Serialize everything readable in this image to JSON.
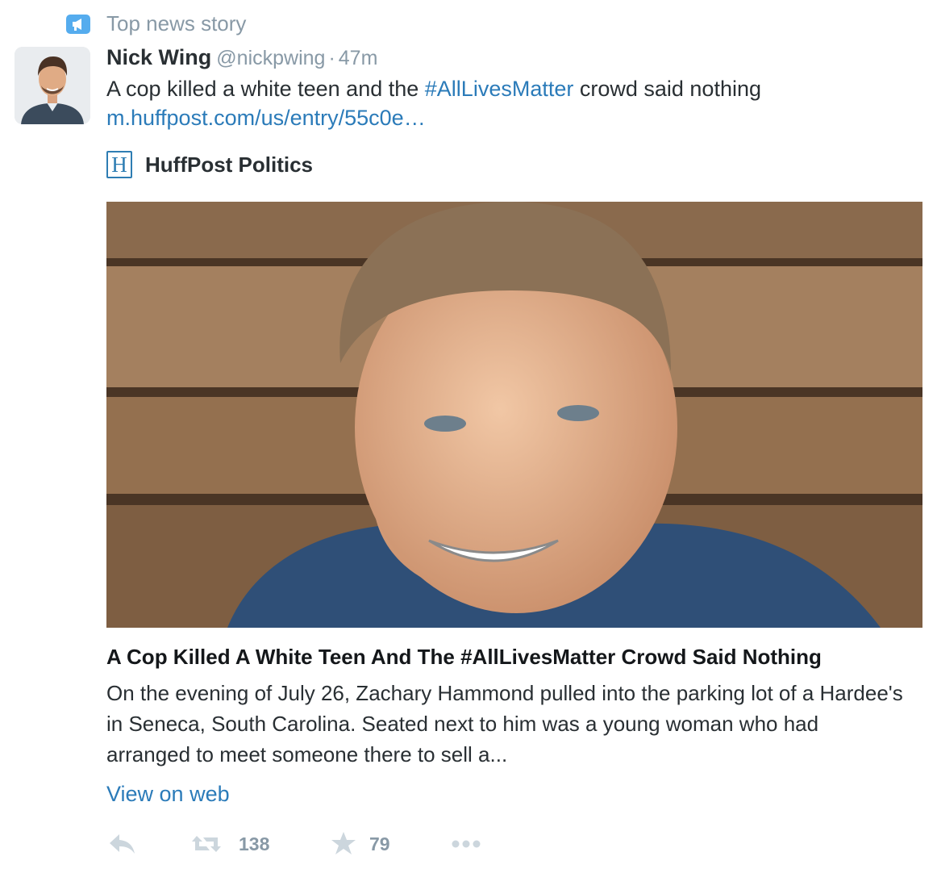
{
  "context": {
    "label": "Top news story",
    "icon": "megaphone-icon"
  },
  "tweet": {
    "fullname": "Nick Wing",
    "username": "@nickpwing",
    "separator": "·",
    "time": "47m",
    "text_before": "A cop killed a white teen and the ",
    "hashtag": "#AllLivesMatter",
    "text_after": " crowd said nothing",
    "url": "m.huffpost.com/us/entry/55c0e…"
  },
  "card": {
    "source_logo_letter": "H",
    "source_name": "HuffPost Politics",
    "title": "A Cop Killed A White Teen And The #AllLivesMatter Crowd Said Nothing",
    "description": "On the evening of July 26, Zachary Hammond pulled into the parking lot of a Hardee's in Seneca, South Carolina. Seated next to him was a young woman who had arranged to meet someone there to sell a...",
    "view_on_web": "View on web"
  },
  "actions": {
    "reply_icon": "reply-icon",
    "retweet_icon": "retweet-icon",
    "retweet_count": "138",
    "favorite_icon": "star-icon",
    "favorite_count": "79",
    "more_icon": "more-icon"
  },
  "colors": {
    "link": "#2b7bb9",
    "muted": "#8899a6",
    "text": "#292f33",
    "context_icon": "#55acee"
  }
}
